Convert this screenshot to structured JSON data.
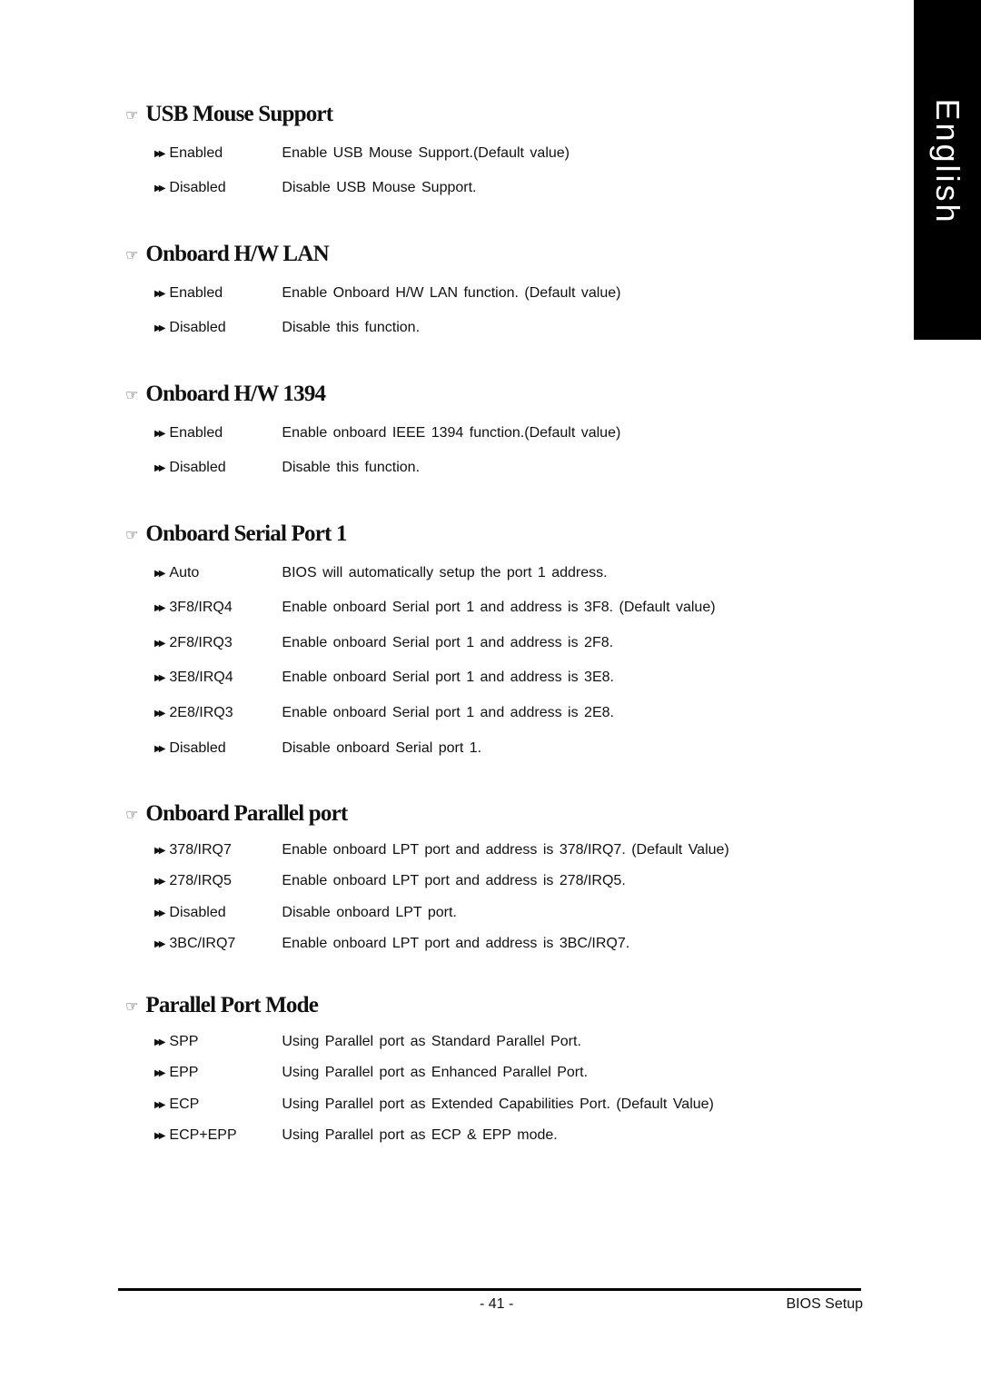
{
  "side_tab": {
    "label": "English"
  },
  "sections": [
    {
      "title": "USB Mouse Support",
      "items": [
        {
          "option": "Enabled",
          "description": "Enable USB Mouse Support.(Default value)"
        },
        {
          "option": "Disabled",
          "description": "Disable USB Mouse Support."
        }
      ]
    },
    {
      "title": "Onboard H/W LAN",
      "items": [
        {
          "option": "Enabled",
          "description": "Enable Onboard H/W LAN function. (Default value)"
        },
        {
          "option": "Disabled",
          "description": "Disable this function."
        }
      ]
    },
    {
      "title": "Onboard  H/W 1394",
      "items": [
        {
          "option": "Enabled",
          "description": "Enable onboard IEEE 1394 function.(Default value)"
        },
        {
          "option": "Disabled",
          "description": "Disable this function."
        }
      ]
    },
    {
      "title": "Onboard Serial Port 1",
      "items": [
        {
          "option": "Auto",
          "description": "BIOS will automatically setup the port 1 address."
        },
        {
          "option": "3F8/IRQ4",
          "description": "Enable onboard Serial port 1 and address is 3F8. (Default value)"
        },
        {
          "option": "2F8/IRQ3",
          "description": "Enable onboard Serial port 1 and address is 2F8."
        },
        {
          "option": "3E8/IRQ4",
          "description": "Enable onboard Serial port 1 and address is 3E8."
        },
        {
          "option": "2E8/IRQ3",
          "description": "Enable onboard Serial port 1 and address is 2E8."
        },
        {
          "option": "Disabled",
          "description": "Disable onboard Serial port 1."
        }
      ]
    },
    {
      "title": "Onboard Parallel port",
      "items": [
        {
          "option": "378/IRQ7",
          "description": "Enable onboard LPT port and address is 378/IRQ7. (Default Value)"
        },
        {
          "option": "278/IRQ5",
          "description": "Enable onboard LPT port and address is 278/IRQ5."
        },
        {
          "option": "Disabled",
          "description": "Disable onboard LPT port."
        },
        {
          "option": "3BC/IRQ7",
          "description": "Enable onboard LPT port and address is 3BC/IRQ7."
        }
      ]
    },
    {
      "title": "Parallel Port Mode",
      "items": [
        {
          "option": "SPP",
          "description": "Using Parallel port as Standard Parallel Port."
        },
        {
          "option": "EPP",
          "description": "Using Parallel port as Enhanced Parallel Port."
        },
        {
          "option": "ECP",
          "description": "Using Parallel port as Extended Capabilities Port. (Default Value)"
        },
        {
          "option": "ECP+EPP",
          "description": "Using Parallel port as ECP & EPP mode."
        }
      ]
    }
  ],
  "icons": {
    "heading_icon": "pointing-hand",
    "item_icon": "double-right-arrow"
  },
  "footer": {
    "page_number": "- 41 -",
    "title": "BIOS Setup"
  }
}
